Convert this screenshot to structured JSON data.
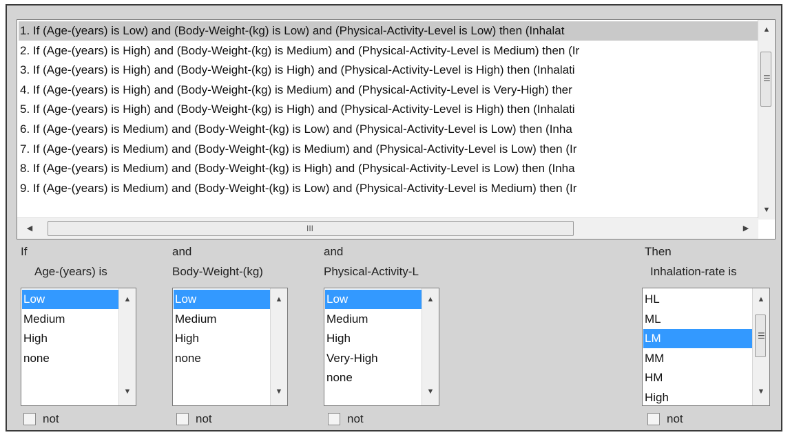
{
  "rules": [
    "1. If (Age-(years) is Low) and (Body-Weight-(kg) is Low) and (Physical-Activity-Level is Low) then (Inhalat",
    "2. If (Age-(years) is High) and (Body-Weight-(kg) is Medium) and (Physical-Activity-Level is Medium) then (Ir",
    "3. If (Age-(years) is High) and (Body-Weight-(kg) is High) and (Physical-Activity-Level is High) then (Inhalati",
    "4. If (Age-(years) is High) and (Body-Weight-(kg) is Medium) and (Physical-Activity-Level is Very-High) ther",
    "5. If (Age-(years) is High) and (Body-Weight-(kg) is High) and (Physical-Activity-Level is High) then (Inhalati",
    "6. If (Age-(years) is Medium) and (Body-Weight-(kg) is Low) and (Physical-Activity-Level is Low) then (Inha",
    "7. If (Age-(years) is Medium) and (Body-Weight-(kg) is Medium) and (Physical-Activity-Level is Low) then (Ir",
    "8. If (Age-(years) is Medium) and (Body-Weight-(kg) is High) and (Physical-Activity-Level is Low) then (Inha",
    "9. If (Age-(years) is Medium) and (Body-Weight-(kg) is Low) and (Physical-Activity-Level is Medium) then (Ir"
  ],
  "selected_rule_index": 0,
  "scroll_glyphs": {
    "up": "▲",
    "down": "▼",
    "left": "◀",
    "right": "▶",
    "vgrip": "☰",
    "hgrip": "III"
  },
  "antecedents": [
    {
      "connector": "If",
      "label": "Age-(years) is",
      "options": [
        "Low",
        "Medium",
        "High",
        "none"
      ],
      "selected": 0,
      "not_label": "not"
    },
    {
      "connector": "and",
      "label": "Body-Weight-(kg)",
      "options": [
        "Low",
        "Medium",
        "High",
        "none"
      ],
      "selected": 0,
      "not_label": "not"
    },
    {
      "connector": "and",
      "label": "Physical-Activity-L",
      "options": [
        "Low",
        "Medium",
        "High",
        "Very-High",
        "none"
      ],
      "selected": 0,
      "not_label": "not"
    }
  ],
  "consequent": {
    "connector": "Then",
    "label": "Inhalation-rate is",
    "options": [
      "HL",
      "ML",
      "LM",
      "MM",
      "HM",
      "High"
    ],
    "selected": 2,
    "not_label": "not"
  },
  "colors": {
    "selection": "#3399ff",
    "rule_selection": "#c9c9c9",
    "panel": "#d4d4d4"
  }
}
